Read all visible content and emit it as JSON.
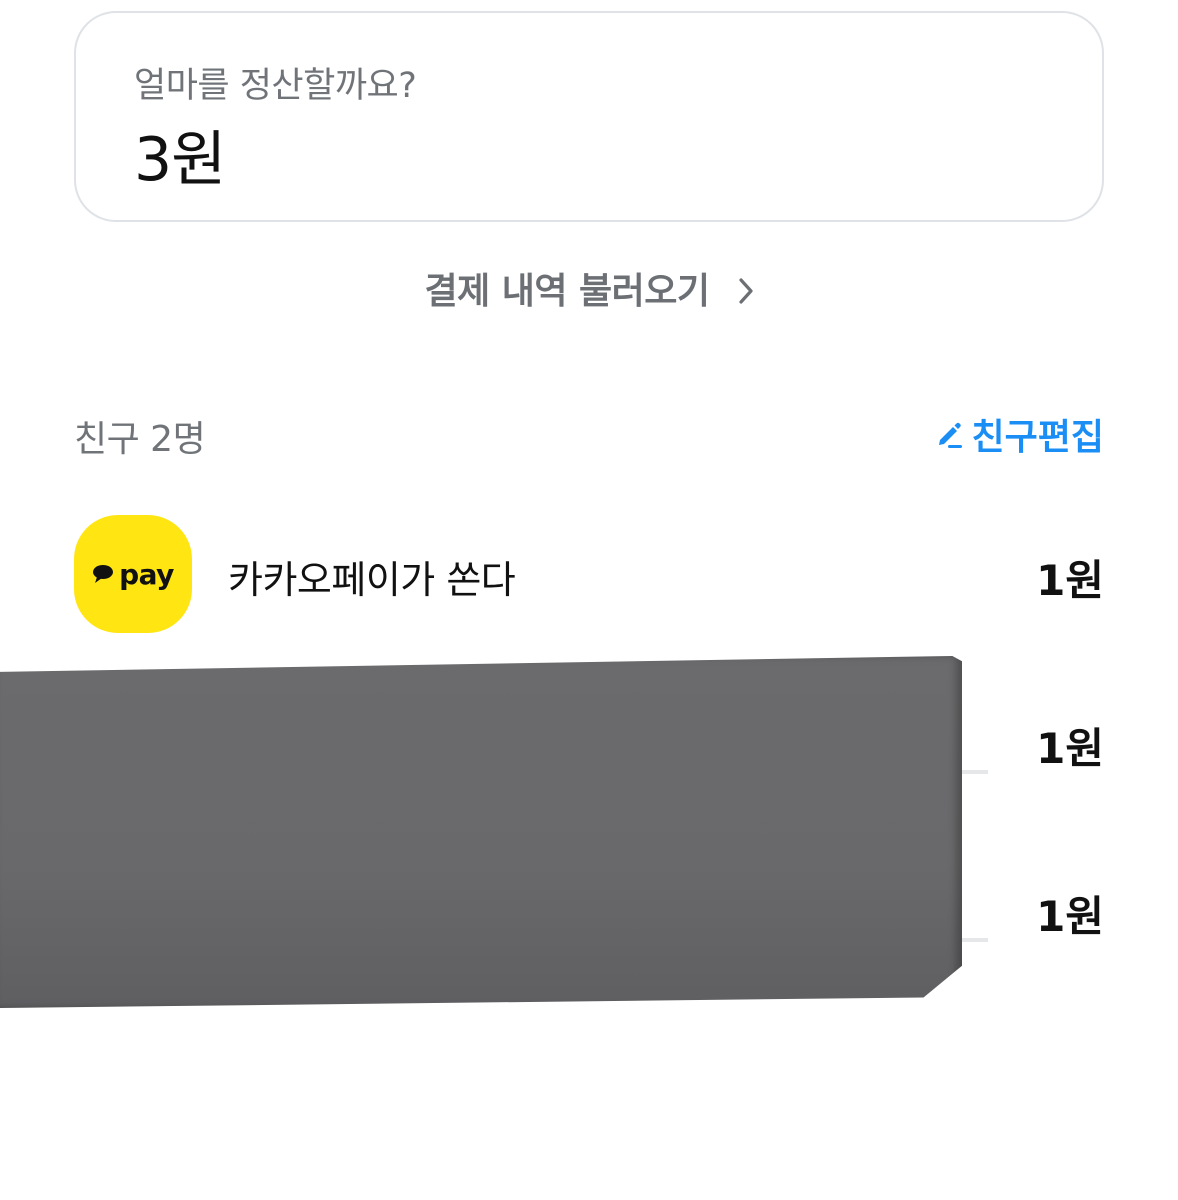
{
  "amount_card": {
    "question": "얼마를 정산할까요?",
    "value": "3원"
  },
  "load_history": {
    "label": "결제 내역 불러오기",
    "icon": "chevron-right-icon"
  },
  "friends": {
    "count_label": "친구 2명",
    "edit_label": "친구편집",
    "edit_icon": "pencil-icon",
    "accent_color": "#1a8ef5",
    "list": [
      {
        "name": "카카오페이가 쏜다",
        "amount": "1원",
        "avatar_text": "pay",
        "avatar_color": "#ffe512"
      },
      {
        "name": "",
        "amount": "1원"
      },
      {
        "name": "",
        "amount": "1원"
      }
    ]
  },
  "redaction": {
    "color": "#69696b"
  }
}
